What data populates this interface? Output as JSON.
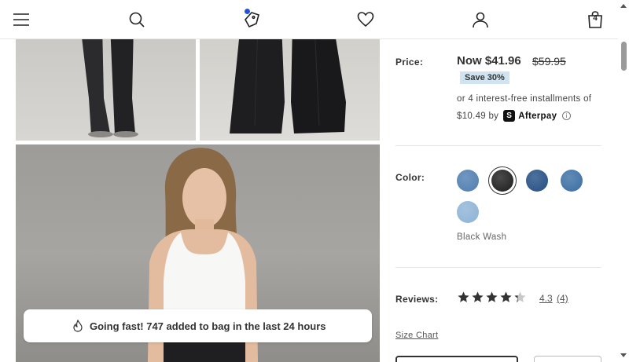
{
  "header": {
    "icons": [
      "menu-icon",
      "search-icon",
      "tag-icon",
      "heart-icon",
      "account-icon",
      "bag-icon"
    ],
    "bag_count": "4"
  },
  "toast": {
    "text": "Going fast! 747 added to bag in the last 24 hours"
  },
  "price": {
    "label": "Price:",
    "now": "Now $41.96",
    "was": "$59.95",
    "save": "Save 30%",
    "installments_line1": "or 4 interest-free installments of",
    "installments_amount": "$10.49 by",
    "afterpay_brand": "Afterpay",
    "afterpay_logo": "S",
    "info": "i"
  },
  "color": {
    "label": "Color:",
    "selected_name": "Black Wash",
    "swatches": [
      {
        "name": "medium-wash",
        "color": "#4f7db0"
      },
      {
        "name": "black-wash",
        "color": "#1d1d1d"
      },
      {
        "name": "dark-wash",
        "color": "#234e83"
      },
      {
        "name": "bright-wash",
        "color": "#3a6ea3"
      },
      {
        "name": "light-wash",
        "color": "#8db3d6"
      }
    ]
  },
  "reviews": {
    "label": "Reviews:",
    "rating": "4.3",
    "count": "(4)",
    "stars_filled": 4.3
  },
  "size_chart": "Size Chart",
  "colors": {
    "badge": "#cfe3f0",
    "text": "#333333"
  }
}
